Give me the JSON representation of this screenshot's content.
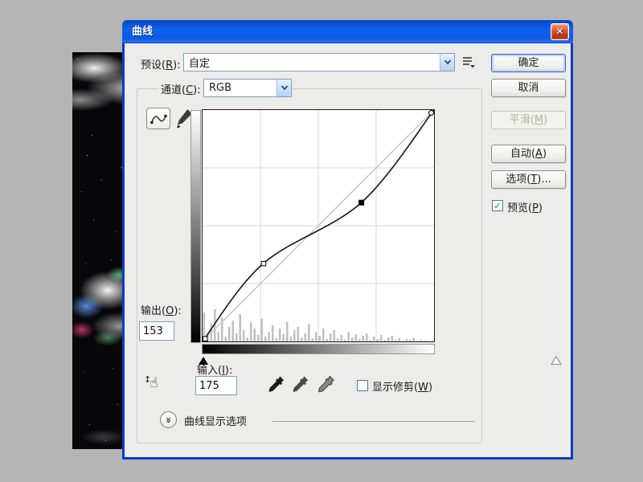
{
  "window": {
    "title": "曲线",
    "close_glyph": "✕"
  },
  "preset": {
    "label": {
      "pre": "预设(",
      "key": "R",
      "post": "):"
    },
    "value": "自定"
  },
  "channel": {
    "label": {
      "pre": "通道(",
      "key": "C",
      "post": "):"
    },
    "value": "RGB"
  },
  "buttons": {
    "ok": "确定",
    "cancel": "取消",
    "smooth": {
      "pre": "平滑(",
      "key": "M",
      "post": ")",
      "enabled": false
    },
    "auto": {
      "pre": "自动(",
      "key": "A",
      "post": ")"
    },
    "options": {
      "pre": "选项(",
      "key": "T",
      "post": ")..."
    }
  },
  "preview": {
    "label": {
      "pre": "预览(",
      "key": "P",
      "post": ")"
    },
    "checked": true,
    "check_glyph": "✓"
  },
  "output": {
    "label": {
      "pre": "输出(",
      "key": "O",
      "post": "):"
    },
    "value": "153"
  },
  "input": {
    "label": {
      "pre": "输入(",
      "key": "I",
      "post": "):"
    },
    "value": "175"
  },
  "clipping": {
    "label": {
      "pre": "显示修剪(",
      "key": "W",
      "post": ")"
    },
    "checked": false
  },
  "display_options": {
    "label": "曲线显示选项",
    "chevron_glyph": "»"
  },
  "chart_data": {
    "type": "line",
    "title": "RGB tone curve",
    "xlabel": "输入",
    "ylabel": "输出",
    "x_range": [
      0,
      255
    ],
    "y_range": [
      0,
      255
    ],
    "grid_divisions": 4,
    "baseline": "diagonal",
    "points": [
      {
        "input": 0,
        "output": 0,
        "marker": "square"
      },
      {
        "input": 67,
        "output": 86,
        "marker": "square"
      },
      {
        "input": 175,
        "output": 153,
        "marker": "selected"
      },
      {
        "input": 255,
        "output": 255,
        "marker": "circle"
      }
    ],
    "histogram": [
      36,
      8,
      22,
      40,
      12,
      30,
      6,
      18,
      26,
      10,
      34,
      14,
      5,
      24,
      16,
      8,
      28,
      6,
      12,
      20,
      4,
      16,
      9,
      24,
      6,
      14,
      18,
      5,
      10,
      22,
      4,
      12,
      7,
      16,
      3,
      10,
      14,
      4,
      8,
      2,
      12,
      5,
      9,
      3,
      7,
      10,
      2,
      6,
      3,
      8,
      2,
      5,
      7,
      2,
      4,
      1,
      3,
      2,
      4,
      1,
      2,
      1,
      1,
      0
    ]
  },
  "colors": {
    "titlebar_blue": "#0b62ee",
    "dialog_border": "#0a3bc8",
    "client_bg": "#ececea",
    "check_green": "#1d9b1d",
    "close_red": "#cc3a14"
  }
}
